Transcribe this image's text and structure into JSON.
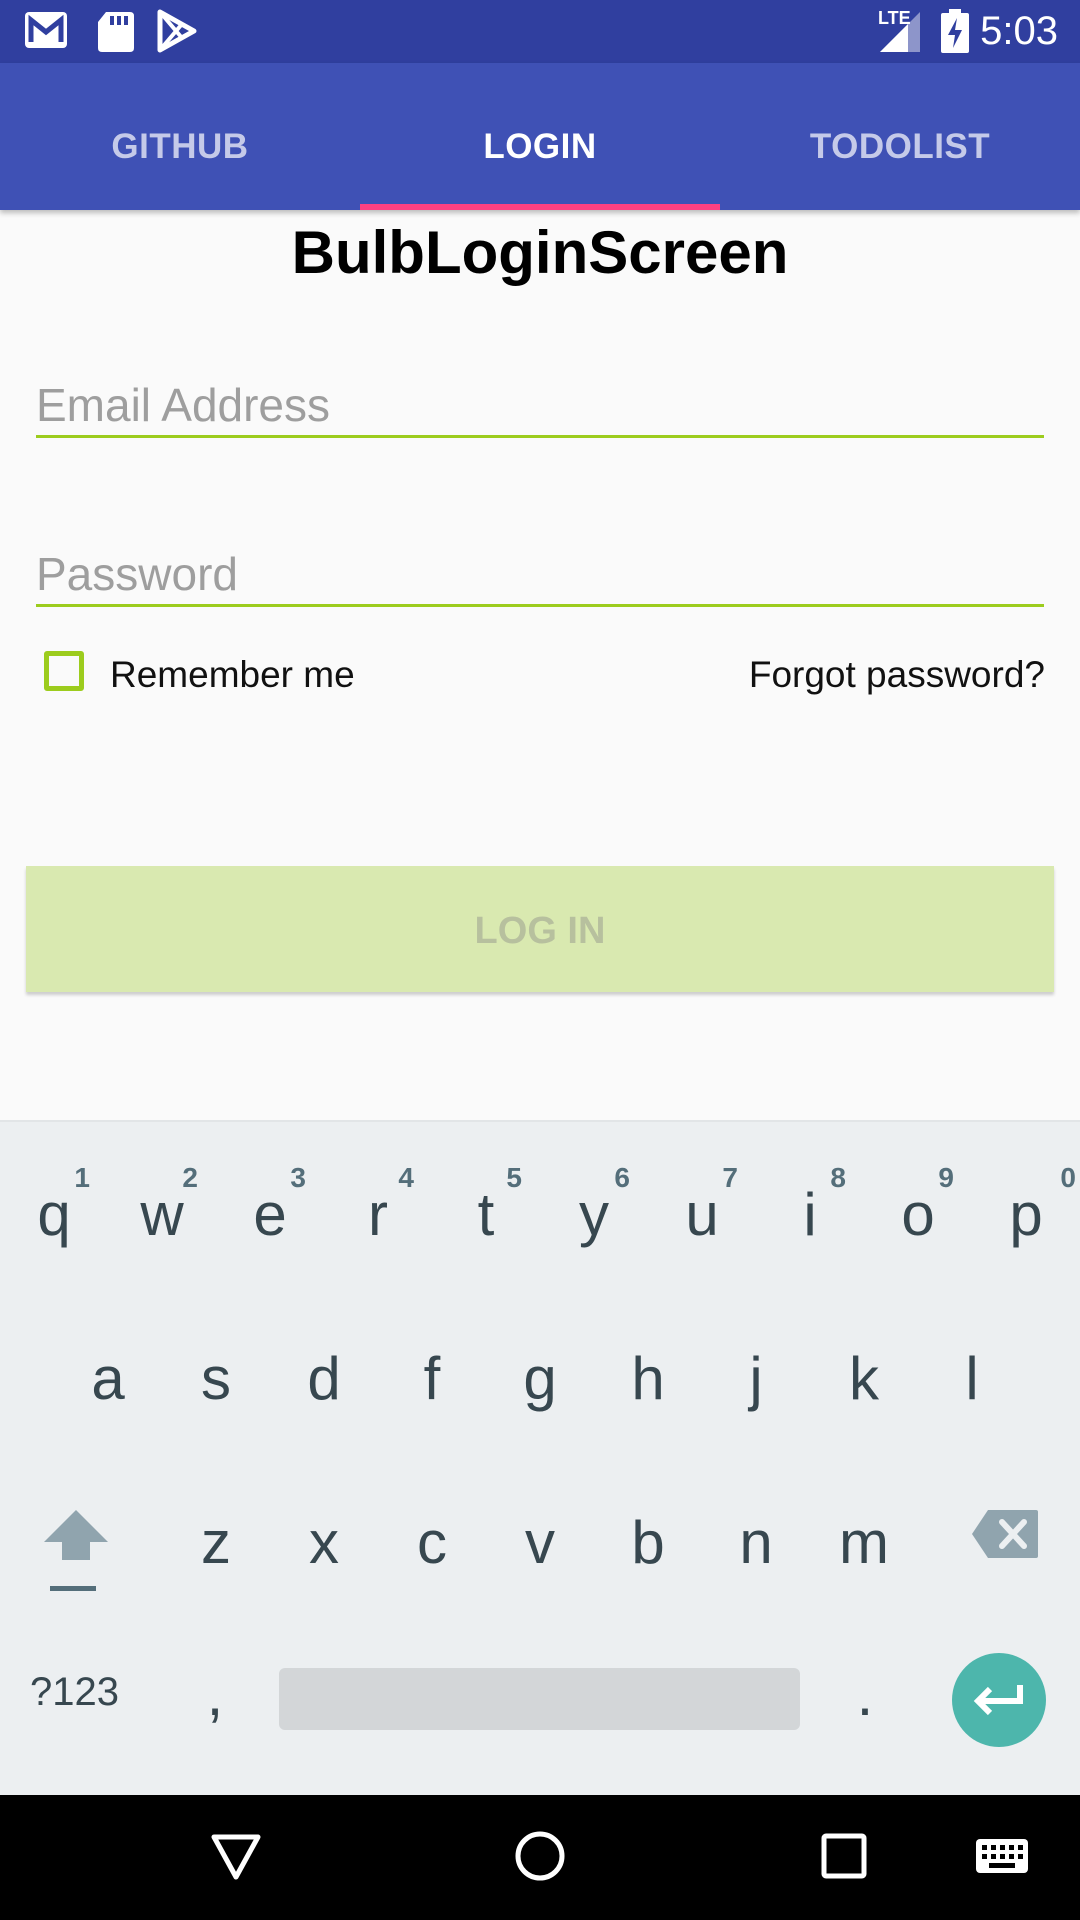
{
  "status_bar": {
    "time": "5:03",
    "network": "LTE",
    "icons": [
      "gmail-icon",
      "sd-card-icon",
      "play-store-icon",
      "signal-icon",
      "battery-charging-icon"
    ]
  },
  "tabs": [
    {
      "label": "GITHUB",
      "active": false
    },
    {
      "label": "LOGIN",
      "active": true
    },
    {
      "label": "TODOLIST",
      "active": false
    }
  ],
  "page": {
    "title": "BulbLoginScreen",
    "email_placeholder": "Email Address",
    "email_value": "",
    "password_placeholder": "Password",
    "password_value": "",
    "remember_label": "Remember me",
    "remember_checked": false,
    "forgot_label": "Forgot password?",
    "login_label": "LOG IN"
  },
  "keyboard": {
    "row1": [
      {
        "key": "q",
        "hint": "1"
      },
      {
        "key": "w",
        "hint": "2"
      },
      {
        "key": "e",
        "hint": "3"
      },
      {
        "key": "r",
        "hint": "4"
      },
      {
        "key": "t",
        "hint": "5"
      },
      {
        "key": "y",
        "hint": "6"
      },
      {
        "key": "u",
        "hint": "7"
      },
      {
        "key": "i",
        "hint": "8"
      },
      {
        "key": "o",
        "hint": "9"
      },
      {
        "key": "p",
        "hint": "0"
      }
    ],
    "row2": [
      "a",
      "s",
      "d",
      "f",
      "g",
      "h",
      "j",
      "k",
      "l"
    ],
    "row3": [
      "z",
      "x",
      "c",
      "v",
      "b",
      "n",
      "m"
    ],
    "symbols_label": "?123",
    "comma": ",",
    "period": ".",
    "special_icons": [
      "shift-icon",
      "backspace-icon",
      "enter-icon"
    ]
  },
  "nav_bar": {
    "icons": [
      "back-icon",
      "home-icon",
      "recents-icon",
      "keyboard-switch-icon"
    ]
  },
  "colors": {
    "status_bar": "#303f9f",
    "primary": "#3f51b5",
    "tab_indicator": "#ff4081",
    "accent_green": "#9ccc1d",
    "login_button_disabled": "#d9e9b0",
    "keyboard_bg": "#eceff1",
    "enter_key": "#4db6ac"
  }
}
